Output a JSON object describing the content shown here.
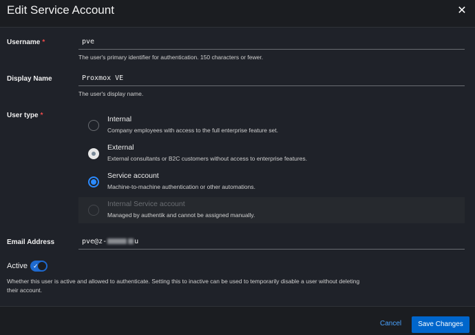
{
  "dialog": {
    "title": "Edit Service Account",
    "close_icon": "close-icon"
  },
  "fields": {
    "username": {
      "label": "Username",
      "required": "*",
      "value": "pve",
      "helper": "The user's primary identifier for authentication. 150 characters or fewer."
    },
    "display_name": {
      "label": "Display Name",
      "value": "Proxmox VE",
      "helper": "The user's display name."
    },
    "user_type": {
      "label": "User type",
      "required": "*",
      "options": [
        {
          "title": "Internal",
          "desc": "Company employees with access to the full enterprise feature set.",
          "state": "unchecked"
        },
        {
          "title": "External",
          "desc": "External consultants or B2C customers without access to enterprise features.",
          "state": "focused"
        },
        {
          "title": "Service account",
          "desc": "Machine-to-machine authentication or other automations.",
          "state": "checked"
        },
        {
          "title": "Internal Service account",
          "desc": "Managed by authentik and cannot be assigned manually.",
          "state": "disabled"
        }
      ]
    },
    "email": {
      "label": "Email Address",
      "value_prefix": "pve@z-",
      "value_suffix": "u"
    },
    "active": {
      "label": "Active",
      "checked": true,
      "helper": "Whether this user is active and allowed to authenticate. Setting this to inactive can be used to temporarily disable a user without deleting their account."
    }
  },
  "footer": {
    "cancel_label": "Cancel",
    "save_label": "Save Changes"
  },
  "colors": {
    "accent": "#0066cc",
    "link": "#4aa3ff",
    "background": "#1f2229",
    "required": "#f04b4b"
  }
}
